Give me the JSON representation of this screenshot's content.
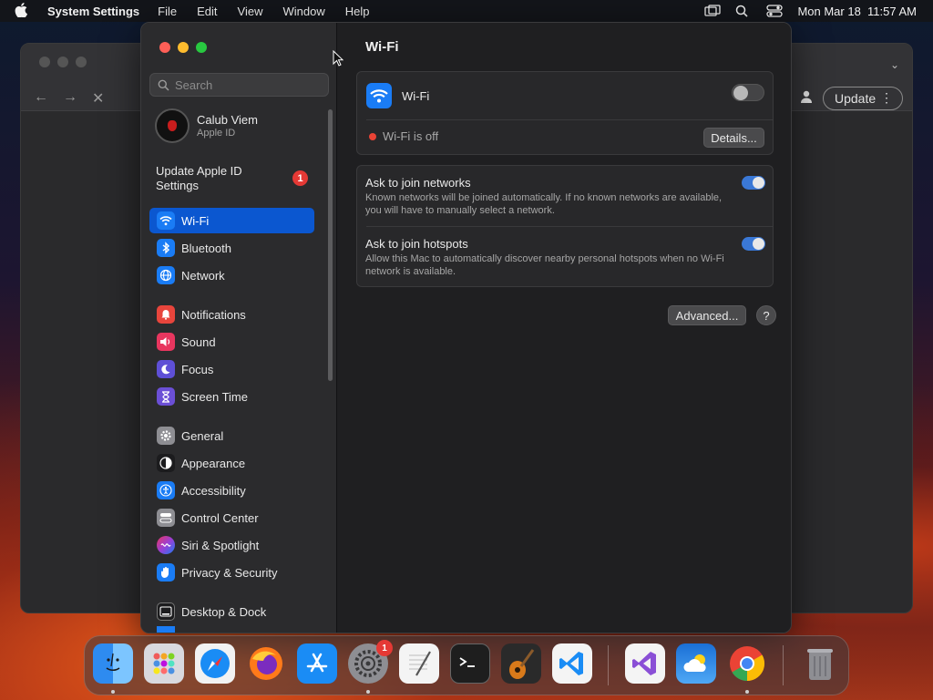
{
  "menubar": {
    "app_name": "System Settings",
    "menus": [
      "File",
      "Edit",
      "View",
      "Window",
      "Help"
    ],
    "datetime": "Mon Mar 18  11:57 AM"
  },
  "browser": {
    "update_label": "Update"
  },
  "sidebar": {
    "search_placeholder": "Search",
    "account": {
      "name": "Calub Viem",
      "subtitle": "Apple ID"
    },
    "update_apple_id": "Update Apple ID Settings",
    "update_badge": "1",
    "items": [
      {
        "label": "Wi-Fi",
        "icon": "wifi-icon",
        "color": "#1a7cf5",
        "active": true
      },
      {
        "label": "Bluetooth",
        "icon": "bluetooth-icon",
        "color": "#1a7cf5"
      },
      {
        "label": "Network",
        "icon": "globe-icon",
        "color": "#1a7cf5"
      },
      {
        "label": "Notifications",
        "icon": "bell-icon",
        "color": "#e8453c"
      },
      {
        "label": "Sound",
        "icon": "speaker-icon",
        "color": "#e8365f"
      },
      {
        "label": "Focus",
        "icon": "moon-icon",
        "color": "#5e4fd6"
      },
      {
        "label": "Screen Time",
        "icon": "hourglass-icon",
        "color": "#6b4fd6"
      },
      {
        "label": "General",
        "icon": "gear-icon",
        "color": "#8e8e93"
      },
      {
        "label": "Appearance",
        "icon": "appearance-icon",
        "color": "#1c1c1e"
      },
      {
        "label": "Accessibility",
        "icon": "accessibility-icon",
        "color": "#1a7cf5"
      },
      {
        "label": "Control Center",
        "icon": "control-center-icon",
        "color": "#8e8e93"
      },
      {
        "label": "Siri & Spotlight",
        "icon": "siri-icon",
        "color": "#9b3fd6"
      },
      {
        "label": "Privacy & Security",
        "icon": "hand-icon",
        "color": "#1a7cf5"
      },
      {
        "label": "Desktop & Dock",
        "icon": "dock-icon",
        "color": "#1c1c1e"
      }
    ]
  },
  "content": {
    "title": "Wi-Fi",
    "wifi": {
      "label": "Wi-Fi",
      "enabled": false,
      "status": "Wi-Fi is off",
      "details_label": "Details..."
    },
    "ask_networks": {
      "title": "Ask to join networks",
      "description": "Known networks will be joined automatically. If no known networks are available, you will have to manually select a network.",
      "enabled": true
    },
    "ask_hotspots": {
      "title": "Ask to join hotspots",
      "description": "Allow this Mac to automatically discover nearby personal hotspots when no Wi-Fi network is available.",
      "enabled": true
    },
    "advanced_label": "Advanced...",
    "help_label": "?"
  },
  "dock": {
    "apps": [
      "Finder",
      "Launchpad",
      "Safari",
      "Firefox",
      "App Store",
      "System Settings",
      "TextEdit",
      "Terminal",
      "GarageBand",
      "Visual Studio Code",
      "Visual Studio",
      "Weather",
      "Chrome",
      "Trash"
    ],
    "settings_badge": "1"
  }
}
